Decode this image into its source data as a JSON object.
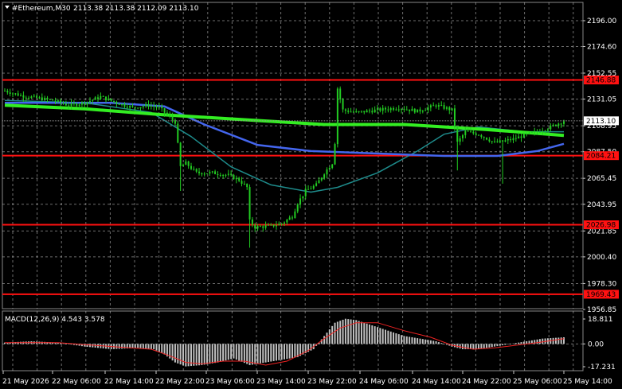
{
  "header": {
    "symbol": "#Ethereum,M30",
    "ohlc": "2113.38 2113.38 2112.09 2113.10"
  },
  "colors": {
    "background": "#000000",
    "grid": "#c8c8c8",
    "candles": "#22cc22",
    "ma_fast": "#33ee22",
    "ma_mid": "#4466ee",
    "ma_slow": "#1e8c8c",
    "level_lines": "#ff1111",
    "price_tag": "#ffffff",
    "macd_hist": "#c0c0c0",
    "macd_signal": "#ee2222"
  },
  "price_axis": {
    "labels": [
      "2196.00",
      "2174.60",
      "2152.55",
      "2131.05",
      "2108.95",
      "2087.50",
      "2065.45",
      "2043.95",
      "2021.85",
      "2000.40",
      "1978.30",
      "1956.85"
    ],
    "current_price": "2113.10"
  },
  "levels": [
    {
      "price": 2146.88,
      "label": "2146.88"
    },
    {
      "price": 2084.21,
      "label": "2084.21"
    },
    {
      "price": 2026.98,
      "label": "2026.98"
    },
    {
      "price": 1969.43,
      "label": "1969.43"
    }
  ],
  "time_axis": {
    "labels": [
      "21 May 2026",
      "22 May 06:00",
      "22 May 14:00",
      "22 May 22:00",
      "23 May 06:00",
      "23 May 14:00",
      "23 May 22:00",
      "24 May 06:00",
      "24 May 14:00",
      "24 May 22:00",
      "25 May 06:00",
      "25 May 14:00"
    ]
  },
  "macd": {
    "label": "MACD(12,26,9) 4.543 3.578",
    "axis_labels": [
      "18.811",
      "0.00",
      "-17.231"
    ]
  },
  "chart_data": {
    "type": "candlestick",
    "title": "#Ethereum,M30",
    "ylim": [
      1956.85,
      2196.0
    ],
    "close_path": [
      [
        0,
        2138
      ],
      [
        6,
        2134
      ],
      [
        12,
        2132
      ],
      [
        18,
        2130
      ],
      [
        24,
        2126
      ],
      [
        30,
        2128
      ],
      [
        36,
        2133
      ],
      [
        42,
        2128
      ],
      [
        48,
        2124
      ],
      [
        54,
        2126
      ],
      [
        58,
        2124
      ],
      [
        61,
        2118
      ],
      [
        64,
        2112
      ],
      [
        66,
        2075
      ],
      [
        68,
        2078
      ],
      [
        72,
        2070
      ],
      [
        78,
        2070
      ],
      [
        84,
        2068
      ],
      [
        88,
        2064
      ],
      [
        91,
        2058
      ],
      [
        92,
        2030
      ],
      [
        94,
        2025
      ],
      [
        100,
        2026
      ],
      [
        104,
        2028
      ],
      [
        108,
        2034
      ],
      [
        110,
        2045
      ],
      [
        113,
        2055
      ],
      [
        117,
        2060
      ],
      [
        120,
        2070
      ],
      [
        123,
        2078
      ],
      [
        124,
        2095
      ],
      [
        125,
        2140
      ],
      [
        127,
        2122
      ],
      [
        132,
        2120
      ],
      [
        140,
        2122
      ],
      [
        148,
        2124
      ],
      [
        155,
        2121
      ],
      [
        162,
        2126
      ],
      [
        168,
        2122
      ],
      [
        170,
        2095
      ],
      [
        173,
        2104
      ],
      [
        178,
        2102
      ],
      [
        184,
        2095
      ],
      [
        187,
        2096
      ],
      [
        191,
        2098
      ],
      [
        195,
        2101
      ],
      [
        200,
        2104
      ],
      [
        205,
        2108
      ],
      [
        210,
        2113
      ]
    ],
    "moving_averages": [
      {
        "color": "#33ee22",
        "points": [
          [
            0,
            2126
          ],
          [
            30,
            2123
          ],
          [
            60,
            2118
          ],
          [
            90,
            2114
          ],
          [
            120,
            2110
          ],
          [
            150,
            2110
          ],
          [
            180,
            2106
          ],
          [
            210,
            2101
          ]
        ]
      },
      {
        "color": "#4466ee",
        "points": [
          [
            0,
            2128
          ],
          [
            40,
            2128
          ],
          [
            60,
            2125
          ],
          [
            75,
            2110
          ],
          [
            95,
            2093
          ],
          [
            115,
            2088
          ],
          [
            140,
            2086
          ],
          [
            165,
            2084
          ],
          [
            185,
            2084
          ],
          [
            200,
            2088
          ],
          [
            210,
            2094
          ]
        ]
      },
      {
        "color": "#1e8c8c",
        "points": [
          [
            0,
            2130
          ],
          [
            30,
            2128
          ],
          [
            55,
            2120
          ],
          [
            70,
            2100
          ],
          [
            85,
            2075
          ],
          [
            100,
            2060
          ],
          [
            115,
            2054
          ],
          [
            125,
            2058
          ],
          [
            140,
            2070
          ],
          [
            155,
            2088
          ],
          [
            165,
            2102
          ],
          [
            178,
            2108
          ],
          [
            195,
            2104
          ],
          [
            210,
            2104
          ]
        ]
      }
    ],
    "macd_histogram": [
      [
        0,
        1
      ],
      [
        10,
        2
      ],
      [
        20,
        1
      ],
      [
        30,
        -2
      ],
      [
        40,
        -4
      ],
      [
        50,
        -3
      ],
      [
        56,
        -4
      ],
      [
        60,
        -8
      ],
      [
        64,
        -14
      ],
      [
        68,
        -17
      ],
      [
        74,
        -16
      ],
      [
        80,
        -14
      ],
      [
        86,
        -11
      ],
      [
        92,
        -16
      ],
      [
        98,
        -14
      ],
      [
        104,
        -12
      ],
      [
        110,
        -10
      ],
      [
        116,
        -4
      ],
      [
        120,
        6
      ],
      [
        124,
        16
      ],
      [
        128,
        19
      ],
      [
        132,
        18
      ],
      [
        138,
        14
      ],
      [
        144,
        10
      ],
      [
        150,
        6
      ],
      [
        156,
        4
      ],
      [
        162,
        2
      ],
      [
        168,
        -2
      ],
      [
        172,
        -4
      ],
      [
        178,
        -4
      ],
      [
        184,
        -2
      ],
      [
        190,
        0
      ],
      [
        196,
        2
      ],
      [
        202,
        4
      ],
      [
        210,
        5
      ]
    ],
    "macd_signal": [
      [
        0,
        1
      ],
      [
        20,
        1
      ],
      [
        40,
        -2
      ],
      [
        55,
        -4
      ],
      [
        62,
        -9
      ],
      [
        68,
        -14
      ],
      [
        74,
        -15
      ],
      [
        82,
        -13
      ],
      [
        90,
        -13
      ],
      [
        98,
        -16
      ],
      [
        106,
        -13
      ],
      [
        114,
        -5
      ],
      [
        120,
        4
      ],
      [
        126,
        12
      ],
      [
        132,
        16
      ],
      [
        140,
        16
      ],
      [
        150,
        10
      ],
      [
        160,
        5
      ],
      [
        168,
        -1
      ],
      [
        176,
        -4
      ],
      [
        184,
        -3
      ],
      [
        192,
        -1
      ],
      [
        200,
        1
      ],
      [
        210,
        4
      ]
    ]
  }
}
